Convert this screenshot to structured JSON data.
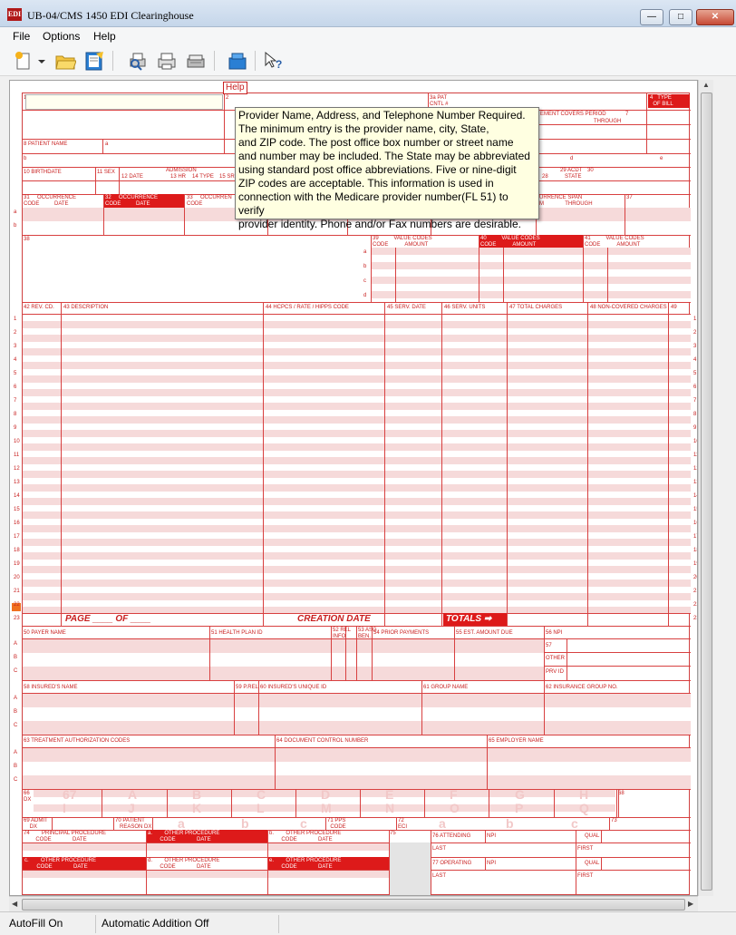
{
  "window": {
    "title": "UB-04/CMS 1450 EDI Clearinghouse",
    "icon_text": "EDI",
    "min_glyph": "—",
    "max_glyph": "□",
    "close_glyph": "✕"
  },
  "menu": [
    "File",
    "Options",
    "Help"
  ],
  "toolbar": {
    "icons": [
      "new-icon",
      "dropdown-arrow-icon",
      "open-folder-icon",
      "edit-form-icon",
      "print-preview-icon",
      "print-icon",
      "print-batch-icon",
      "transmit-icon",
      "help-pointer-icon"
    ]
  },
  "help_button": "Help",
  "tooltip": {
    "text": "Provider Name, Address, and Telephone Number Required.\nThe minimum entry is the provider name, city, State,\nand ZIP code. The post office box number or street name\nand number may be included. The State may be abbreviated\nusing standard post office abbreviations. Five or nine-digit\nZIP codes are acceptable. This information is used in\nconnection with the Medicare provider number(FL 51) to verify\nprovider identity. Phone and/or Fax numbers are desirable."
  },
  "form": {
    "fl1": "1",
    "fl2": "2",
    "fl3a": "3a PAT\nCNTL #",
    "fl4": "4   TYPE\n  OF BILL",
    "fl6": "EMENT COVERS PERIOD",
    "fl6_through": "THROUGH",
    "fl7": "7",
    "fl8": "8 PATIENT  NAME",
    "fl8a": "a",
    "fl9b": "b",
    "fl9d": "d",
    "fl9e": "e",
    "fl10": "10 BIRTHDATE",
    "fl11": "11 SEX",
    "fl12": "12     DATE",
    "admission": "ADMISSION",
    "fl13": "13 HR",
    "fl14": "14 TYPE",
    "fl15": "15 SRC",
    "fl28": "28",
    "fl29": "29 ACDT\n   STATE",
    "fl30": "30",
    "fl31": "31     OCCURRENCE\nCODE          DATE",
    "fl32": "32     OCCURRENCE\nCODE          DATE",
    "fl33": "33     OCCURREN\nCODE",
    "fl35": "URRENCE SPAN\nM              THROUGH",
    "fl37": "37",
    "fl38": "38",
    "fl39": "39          VALUE CODES\nCODE           AMOUNT",
    "fl40": "40          VALUE CODES\nCODE           AMOUNT",
    "fl41": "41          VALUE CODES\nCODE           AMOUNT",
    "value_rows": [
      "a",
      "b",
      "c",
      "d"
    ],
    "fl42": "42 REV. CD.",
    "fl43": "43 DESCRIPTION",
    "fl44": "44 HCPCS / RATE / HIPPS CODE",
    "fl45": "45 SERV. DATE",
    "fl46": "46 SERV. UNITS",
    "fl47": "47 TOTAL CHARGES",
    "fl48": "48 NON-COVERED CHARGES",
    "fl49": "49",
    "line_numbers": [
      "1",
      "2",
      "3",
      "4",
      "5",
      "6",
      "7",
      "8",
      "9",
      "10",
      "11",
      "12",
      "13",
      "14",
      "15",
      "16",
      "17",
      "18",
      "19",
      "20",
      "21",
      "22",
      "23"
    ],
    "page_label": "PAGE ____  OF ____",
    "creation_date": "CREATION DATE",
    "totals": "TOTALS",
    "fl50": "50 PAYER  NAME",
    "fl51": "51 HEALTH PLAN ID",
    "fl52": "52 REL\nINFO",
    "fl53": "53 ASG\nBEN.",
    "fl54": "54 PRIOR PAYMENTS",
    "fl55": "55 EST. AMOUNT DUE",
    "fl56": "56 NPI",
    "fl57": "57",
    "other": "OTHER",
    "prv_id": "PRV ID",
    "abc": [
      "A",
      "B",
      "C"
    ],
    "fl58": "58 INSURED'S NAME",
    "fl59": "59 P.REL",
    "fl60": "60 INSURED'S UNIQUE ID",
    "fl61": "61 GROUP NAME",
    "fl62": "62 INSURANCE GROUP NO.",
    "fl63": "63 TREATMENT AUTHORIZATION CODES",
    "fl64": "64 DOCUMENT CONTROL NUMBER",
    "fl65": "65 EMPLOYER NAME",
    "fl66": "66\nDX",
    "dx_letters_top": [
      "67",
      "A",
      "B",
      "C",
      "D",
      "E",
      "F",
      "G",
      "H"
    ],
    "dx_letters_bottom": [
      "I",
      "J",
      "K",
      "L",
      "M",
      "N",
      "O",
      "P",
      "Q"
    ],
    "fl68": "68",
    "fl69": "69 ADMIT\n    DX",
    "fl70": "70 PATIENT\n   REASON DX",
    "fl70_letters": [
      "a",
      "b",
      "c"
    ],
    "fl71": "71 PPS\n  CODE",
    "fl72": "72\nECI",
    "fl72_letters": [
      "a",
      "b",
      "c"
    ],
    "fl73": "73",
    "fl74": "74        PRINCIPAL PROCEDURE\n        CODE              DATE",
    "fl74a": "a.        OTHER PROCEDURE\n        CODE              DATE",
    "fl74b": "b.        OTHER PROCEDURE\n        CODE              DATE",
    "fl74c": "c.        OTHER PROCEDURE\n        CODE              DATE",
    "fl74d": "d.        OTHER PROCEDURE\n        CODE              DATE",
    "fl74e": "e.        OTHER PROCEDURE\n        CODE              DATE",
    "fl75": "75",
    "fl76": "76 ATTENDING",
    "fl77": "77 OPERATING",
    "npi": "NPI",
    "qual": "QUAL",
    "last": "LAST",
    "first": "FIRST"
  },
  "status": {
    "autofill": "AutoFill On",
    "auto_addition": "Automatic Addition Off"
  },
  "colors": {
    "form_red": "#d84040",
    "header_fill": "#dd1a1a",
    "stripe_pink": "#f6dada",
    "tooltip_bg": "#ffffe1"
  }
}
